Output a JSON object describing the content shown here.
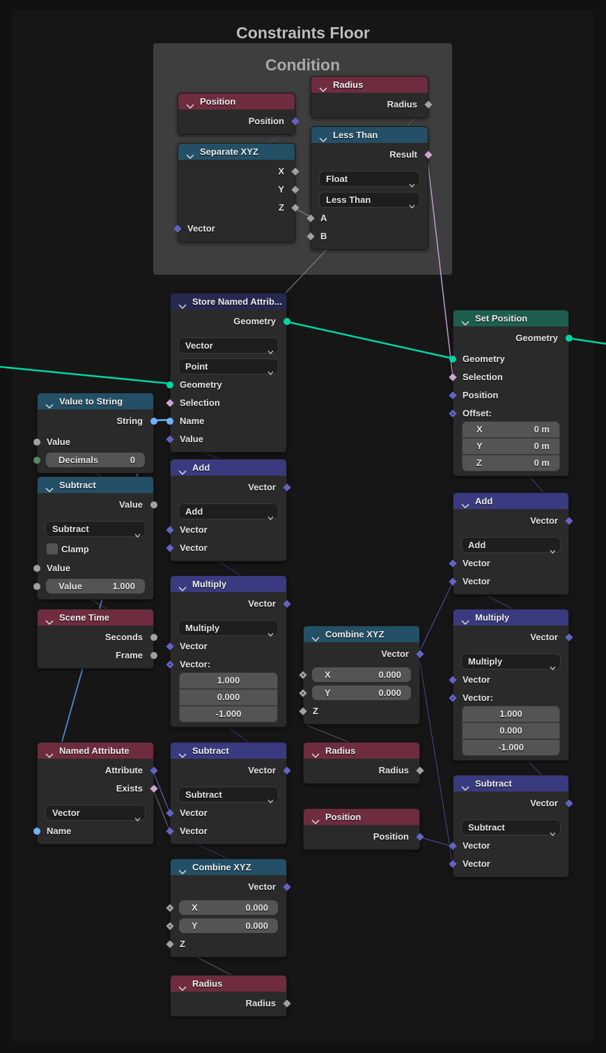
{
  "frames": {
    "outer_title": "Constraints Floor",
    "condition_title": "Condition"
  },
  "colors": {
    "header_input": "#6e2c3e",
    "header_converter": "#235066",
    "header_vector": "#3a3a80",
    "header_geometry": "#1e5e4e",
    "header_attribute": "#27284f",
    "socket_geometry": "#00d6a3",
    "socket_float": "#a1a1a1",
    "socket_vector": "#6363c7",
    "socket_bool": "#cca6d6",
    "socket_string": "#70b2ff",
    "socket_int": "#598c5c"
  },
  "nodes": [
    {
      "title": "Position",
      "header": "input",
      "rows": [
        {
          "t": "out",
          "label": "Position",
          "sock": "vector"
        }
      ]
    },
    {
      "title": "Radius",
      "header": "input",
      "rows": [
        {
          "t": "out",
          "label": "Radius",
          "sock": "float-field"
        }
      ]
    },
    {
      "title": "Separate XYZ",
      "header": "converter",
      "rows": [
        {
          "t": "out",
          "label": "X",
          "sock": "float-field"
        },
        {
          "t": "out",
          "label": "Y",
          "sock": "float-field"
        },
        {
          "t": "out",
          "label": "Z",
          "sock": "float-field"
        },
        {
          "t": "in",
          "label": "Vector",
          "sock": "vector"
        }
      ]
    },
    {
      "title": "Less Than",
      "header": "converter",
      "rows": [
        {
          "t": "out",
          "label": "Result",
          "sock": "bool"
        },
        {
          "t": "dd",
          "label": "Float"
        },
        {
          "t": "dd",
          "label": "Less Than"
        },
        {
          "t": "in",
          "label": "A",
          "sock": "float-field"
        },
        {
          "t": "in",
          "label": "B",
          "sock": "float-field"
        }
      ]
    },
    {
      "title": "Store Named Attrib...",
      "header": "attribute",
      "rows": [
        {
          "t": "out",
          "label": "Geometry",
          "sock": "geometry"
        },
        {
          "t": "dd",
          "label": "Vector"
        },
        {
          "t": "dd",
          "label": "Point"
        },
        {
          "t": "in",
          "label": "Geometry",
          "sock": "geometry"
        },
        {
          "t": "in",
          "label": "Selection",
          "sock": "bool"
        },
        {
          "t": "in",
          "label": "Name",
          "sock": "string"
        },
        {
          "t": "in",
          "label": "Value",
          "sock": "vector"
        }
      ]
    },
    {
      "title": "Set Position",
      "header": "geometry",
      "rows": [
        {
          "t": "out",
          "label": "Geometry",
          "sock": "geometry"
        },
        {
          "t": "in",
          "label": "Geometry",
          "sock": "geometry"
        },
        {
          "t": "in",
          "label": "Selection",
          "sock": "bool"
        },
        {
          "t": "in",
          "label": "Position",
          "sock": "vector"
        },
        {
          "t": "lbl",
          "label": "Offset:",
          "sock": "vector-hollow"
        },
        {
          "t": "vf",
          "label": "X",
          "value": "0 m"
        },
        {
          "t": "vf",
          "label": "Y",
          "value": "0 m"
        },
        {
          "t": "vf",
          "label": "Z",
          "value": "0 m"
        }
      ]
    },
    {
      "title": "Value to String",
      "header": "converter",
      "rows": [
        {
          "t": "out",
          "label": "String",
          "sock": "string"
        },
        {
          "t": "in",
          "label": "Value",
          "sock": "float"
        },
        {
          "t": "field",
          "label": "Decimals",
          "value": "0",
          "sock": "int"
        }
      ]
    },
    {
      "title": "Subtract",
      "header": "converter",
      "rows": [
        {
          "t": "out",
          "label": "Value",
          "sock": "float"
        },
        {
          "t": "dd",
          "label": "Subtract"
        },
        {
          "t": "check",
          "label": "Clamp"
        },
        {
          "t": "in",
          "label": "Value",
          "sock": "float"
        },
        {
          "t": "field",
          "label": "Value",
          "value": "1.000",
          "sock": "float"
        }
      ]
    },
    {
      "title": "Scene Time",
      "header": "input",
      "rows": [
        {
          "t": "out",
          "label": "Seconds",
          "sock": "float"
        },
        {
          "t": "out",
          "label": "Frame",
          "sock": "float"
        }
      ]
    },
    {
      "title": "Named Attribute",
      "header": "input",
      "rows": [
        {
          "t": "out",
          "label": "Attribute",
          "sock": "vector"
        },
        {
          "t": "out",
          "label": "Exists",
          "sock": "bool"
        },
        {
          "t": "dd",
          "label": "Vector"
        },
        {
          "t": "in",
          "label": "Name",
          "sock": "string"
        }
      ]
    },
    {
      "title": "Add",
      "header": "vector",
      "rows": [
        {
          "t": "out",
          "label": "Vector",
          "sock": "vector"
        },
        {
          "t": "dd",
          "label": "Add"
        },
        {
          "t": "in",
          "label": "Vector",
          "sock": "vector"
        },
        {
          "t": "in",
          "label": "Vector",
          "sock": "vector"
        }
      ]
    },
    {
      "title": "Multiply",
      "header": "vector",
      "rows": [
        {
          "t": "out",
          "label": "Vector",
          "sock": "vector"
        },
        {
          "t": "dd",
          "label": "Multiply"
        },
        {
          "t": "in",
          "label": "Vector",
          "sock": "vector"
        },
        {
          "t": "lbl",
          "label": "Vector:",
          "sock": "vector-hollow"
        },
        {
          "t": "vf",
          "value": "1.000"
        },
        {
          "t": "vf",
          "value": "0.000"
        },
        {
          "t": "vf",
          "value": "-1.000"
        }
      ]
    },
    {
      "title": "Combine XYZ",
      "header": "converter",
      "rows": [
        {
          "t": "out",
          "label": "Vector",
          "sock": "vector"
        },
        {
          "t": "field",
          "label": "X",
          "value": "0.000",
          "sock": "float-hollow"
        },
        {
          "t": "field",
          "label": "Y",
          "value": "0.000",
          "sock": "float-hollow"
        },
        {
          "t": "in",
          "label": "Z",
          "sock": "float-field"
        }
      ]
    },
    {
      "title": "Radius",
      "header": "input",
      "rows": [
        {
          "t": "out",
          "label": "Radius",
          "sock": "float-field"
        }
      ]
    },
    {
      "title": "Position",
      "header": "input",
      "rows": [
        {
          "t": "out",
          "label": "Position",
          "sock": "vector"
        }
      ]
    },
    {
      "title": "Subtract",
      "header": "vector",
      "rows": [
        {
          "t": "out",
          "label": "Vector",
          "sock": "vector"
        },
        {
          "t": "dd",
          "label": "Subtract"
        },
        {
          "t": "in",
          "label": "Vector",
          "sock": "vector"
        },
        {
          "t": "in",
          "label": "Vector",
          "sock": "vector"
        }
      ]
    },
    {
      "title": "Combine XYZ",
      "header": "converter",
      "rows": [
        {
          "t": "out",
          "label": "Vector",
          "sock": "vector"
        },
        {
          "t": "field",
          "label": "X",
          "value": "0.000",
          "sock": "float-hollow"
        },
        {
          "t": "field",
          "label": "Y",
          "value": "0.000",
          "sock": "float-hollow"
        },
        {
          "t": "in",
          "label": "Z",
          "sock": "float-field"
        }
      ]
    },
    {
      "title": "Radius",
      "header": "input",
      "rows": [
        {
          "t": "out",
          "label": "Radius",
          "sock": "float-field"
        }
      ]
    },
    {
      "title": "Add",
      "header": "vector",
      "rows": [
        {
          "t": "out",
          "label": "Vector",
          "sock": "vector"
        },
        {
          "t": "dd",
          "label": "Add"
        },
        {
          "t": "in",
          "label": "Vector",
          "sock": "vector"
        },
        {
          "t": "in",
          "label": "Vector",
          "sock": "vector"
        }
      ]
    },
    {
      "title": "Multiply",
      "header": "vector",
      "rows": [
        {
          "t": "out",
          "label": "Vector",
          "sock": "vector"
        },
        {
          "t": "dd",
          "label": "Multiply"
        },
        {
          "t": "in",
          "label": "Vector",
          "sock": "vector"
        },
        {
          "t": "lbl",
          "label": "Vector:",
          "sock": "vector-hollow"
        },
        {
          "t": "vf",
          "value": "1.000"
        },
        {
          "t": "vf",
          "value": "0.000"
        },
        {
          "t": "vf",
          "value": "-1.000"
        }
      ]
    },
    {
      "title": "Subtract",
      "header": "vector",
      "rows": [
        {
          "t": "out",
          "label": "Vector",
          "sock": "vector"
        },
        {
          "t": "dd",
          "label": "Subtract"
        },
        {
          "t": "in",
          "label": "Vector",
          "sock": "vector"
        },
        {
          "t": "in",
          "label": "Vector",
          "sock": "vector"
        }
      ]
    }
  ]
}
